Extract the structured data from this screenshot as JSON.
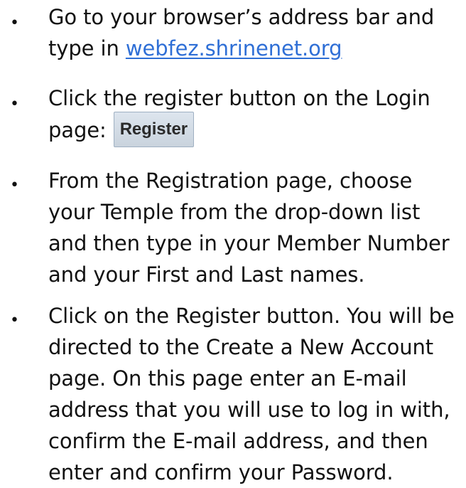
{
  "steps": [
    {
      "lines": [
        "Go to your browser’s address bar and"
      ],
      "prefix": "type in ",
      "link_text": "webfez.shrinenet.org"
    },
    {
      "lines": [
        "Click the register button on the Login"
      ],
      "prefix": "page:",
      "button_label": "Register"
    },
    {
      "lines": [
        "From the Registration page, choose",
        "your Temple from the drop-down list",
        "and then type in your Member Number",
        "and your First and Last names."
      ]
    },
    {
      "lines": [
        "Click on the Register button. You will be",
        "directed to the Create a New Account",
        "page. On this page enter an E-mail",
        "address that you will use to log in with,",
        "confirm the E-mail address, and then",
        "enter and confirm your Password."
      ]
    }
  ],
  "bullet_char": "•",
  "colors": {
    "link": "#2f6fd6",
    "button_bg": "#d3dbe4",
    "text": "#111111"
  }
}
